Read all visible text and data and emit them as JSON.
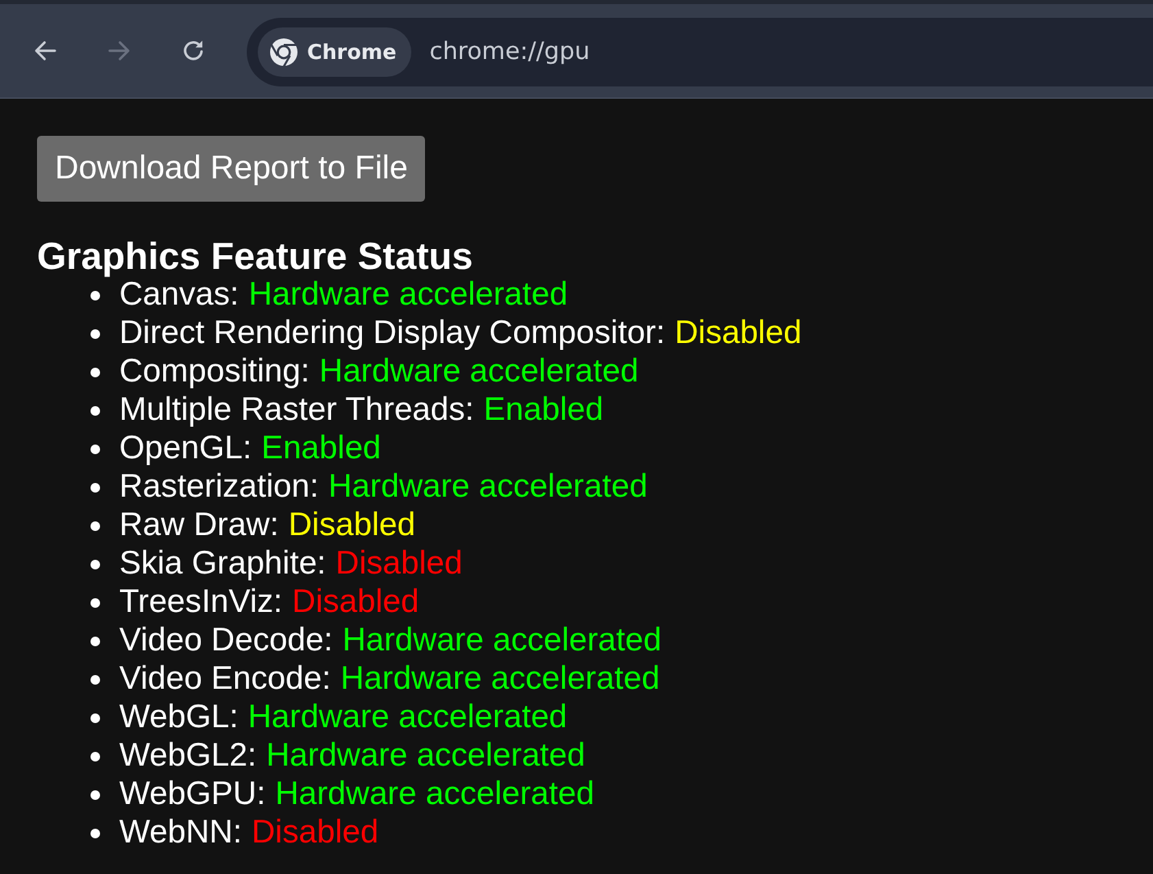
{
  "toolbar": {
    "nav_buttons": [
      {
        "kind": "back",
        "disabled": false
      },
      {
        "kind": "forward",
        "disabled": true
      },
      {
        "kind": "reload",
        "disabled": false
      }
    ],
    "site_chip": {
      "label": "Chrome"
    },
    "address": {
      "value": "chrome://gpu"
    }
  },
  "download_button": {
    "label": "Download Report to File"
  },
  "section": {
    "title": "Graphics Feature Status",
    "features": [
      {
        "name": "Canvas:",
        "status": "Hardware accelerated",
        "color": "#00ff00"
      },
      {
        "name": "Direct Rendering Display Compositor:",
        "status": "Disabled",
        "color": "#ffff00"
      },
      {
        "name": "Compositing:",
        "status": "Hardware accelerated",
        "color": "#00ff00"
      },
      {
        "name": "Multiple Raster Threads:",
        "status": "Enabled",
        "color": "#00ff00"
      },
      {
        "name": "OpenGL:",
        "status": "Enabled",
        "color": "#00ff00"
      },
      {
        "name": "Rasterization:",
        "status": "Hardware accelerated",
        "color": "#00ff00"
      },
      {
        "name": "Raw Draw:",
        "status": "Disabled",
        "color": "#ffff00"
      },
      {
        "name": "Skia Graphite:",
        "status": "Disabled",
        "color": "#ff0000"
      },
      {
        "name": "TreesInViz:",
        "status": "Disabled",
        "color": "#ff0000"
      },
      {
        "name": "Video Decode:",
        "status": "Hardware accelerated",
        "color": "#00ff00"
      },
      {
        "name": "Video Encode:",
        "status": "Hardware accelerated",
        "color": "#00ff00"
      },
      {
        "name": "WebGL:",
        "status": "Hardware accelerated",
        "color": "#00ff00"
      },
      {
        "name": "WebGL2:",
        "status": "Hardware accelerated",
        "color": "#00ff00"
      },
      {
        "name": "WebGPU:",
        "status": "Hardware accelerated",
        "color": "#00ff00"
      },
      {
        "name": "WebNN:",
        "status": "Disabled",
        "color": "#ff0000"
      }
    ]
  }
}
